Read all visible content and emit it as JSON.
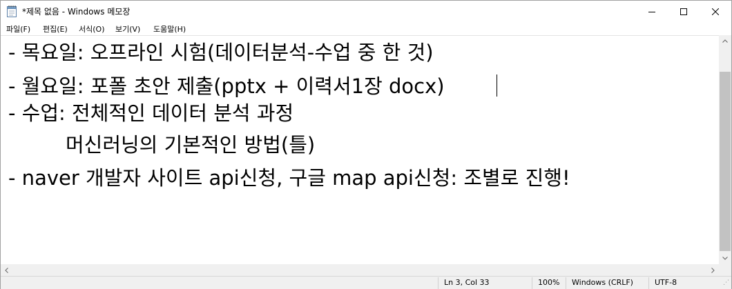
{
  "window": {
    "title": "*제목 없음 - Windows 메모장",
    "app_icon": "notepad-icon",
    "controls": {
      "minimize_icon": "minimize-icon",
      "maximize_icon": "maximize-icon",
      "close_icon": "close-icon"
    }
  },
  "menu": {
    "items": [
      {
        "label": "파일(F)"
      },
      {
        "label": "편집(E)"
      },
      {
        "label": "서식(O)"
      },
      {
        "label": "보기(V)"
      },
      {
        "label": "도움말(H)"
      }
    ]
  },
  "editor": {
    "lines": [
      "- 목요일: 오프라인 시험(데이터분석-수업 중 한 것)",
      "- 월요일: 포폴 초안 제출(pptx + 이력서1장 docx)",
      "- 수업: 전체적인 데이터 분석 과정",
      "         머신러닝의 기본적인 방법(틀)",
      "- naver 개발자 사이트 api신청, 구글 map api신청: 조별로 진행!"
    ]
  },
  "statusbar": {
    "position": "Ln 3, Col 33",
    "zoom": "100%",
    "line_ending": "Windows (CRLF)",
    "encoding": "UTF-8"
  },
  "colors": {
    "scrollbar_track": "#f0f0f0",
    "scrollbar_thumb": "#c2c2c2",
    "text": "#000000"
  }
}
